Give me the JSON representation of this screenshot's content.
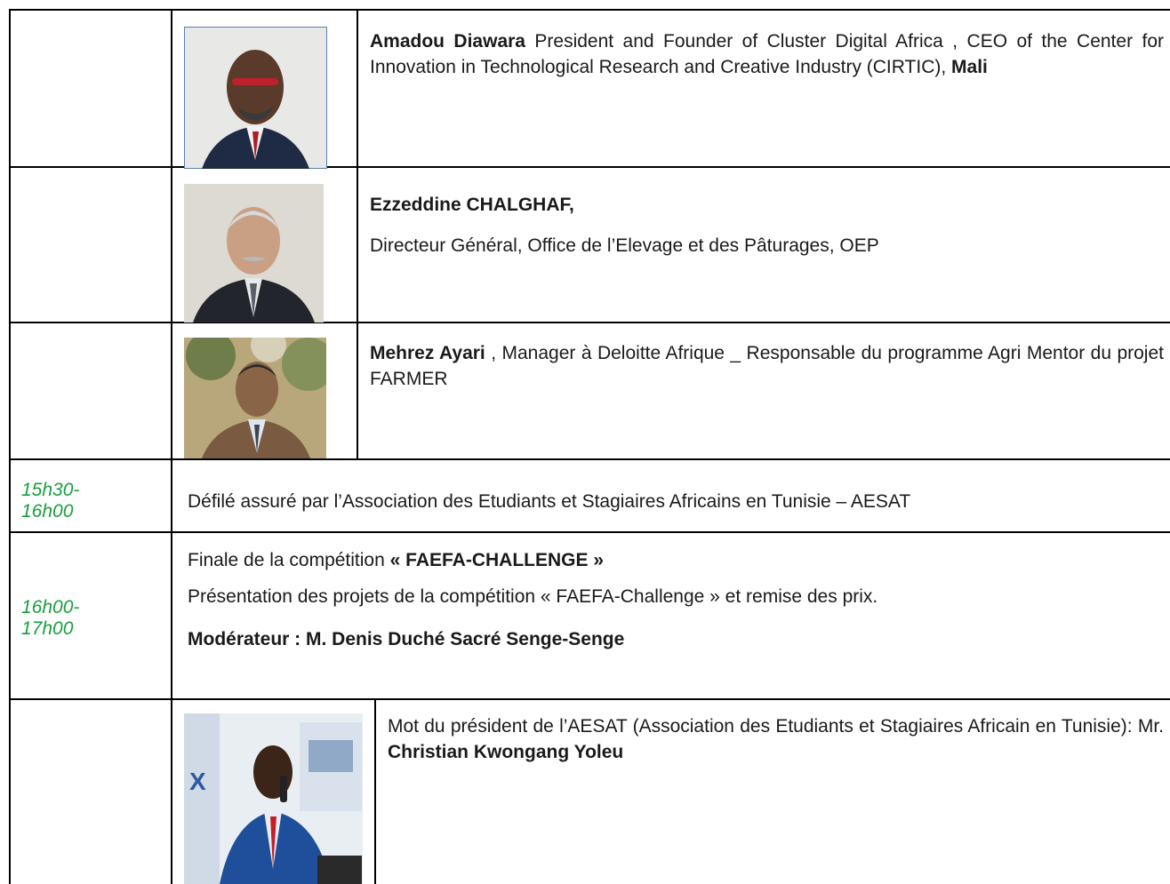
{
  "rows": [
    {
      "speaker": {
        "name": "Amadou Diawara",
        "text1": " President and Founder of Cluster Digital Africa , CEO of the Center for Innovation in Technological Research and Creative Industry (CIRTIC), ",
        "country": "Mali"
      }
    },
    {
      "speaker": {
        "name": "Ezzeddine CHALGHAF,",
        "title": "Directeur Général, Office de l’Elevage et des Pâturages,  OEP"
      }
    },
    {
      "speaker": {
        "name": "Mehrez Ayari",
        "text1": " , Manager à Deloitte Afrique _ Responsable du programme Agri Mentor du projet FARMER"
      }
    },
    {
      "time": "15h30-\n16h00",
      "text": "Défilé assuré par l’Association des Etudiants et Stagiaires Africains en Tunisie – AESAT"
    },
    {
      "time": "16h00-\n17h00",
      "line1_prefix": "Finale de la compétition ",
      "line1_bold": "« FAEFA-CHALLENGE »",
      "line2": "Présentation des projets de la compétition « FAEFA-Challenge » et remise des prix.",
      "line3": "Modérateur : M. Denis Duché Sacré Senge-Senge"
    },
    {
      "speaker": {
        "text1": " Mot du président de l’AESAT (Association des Etudiants et Stagiaires Africain en Tunisie): Mr. ",
        "name": "Christian Kwongang Yoleu"
      }
    }
  ]
}
